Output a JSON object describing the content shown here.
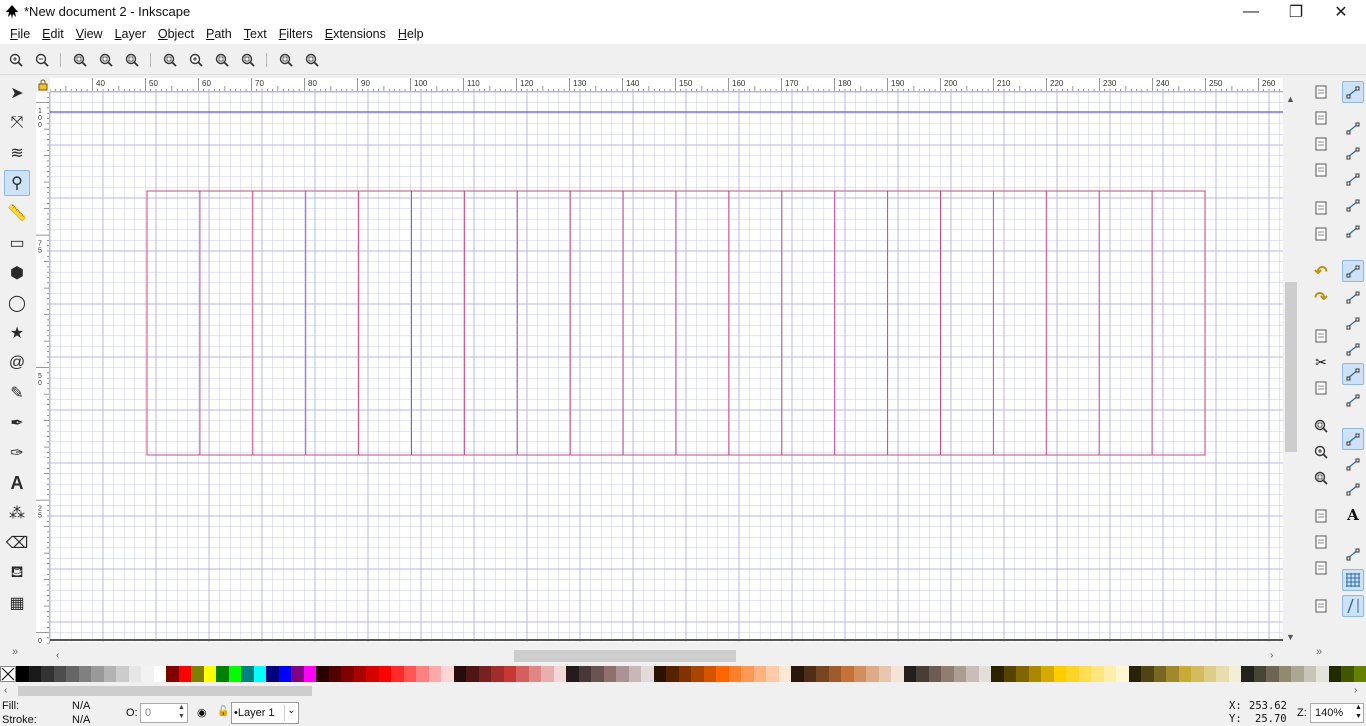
{
  "window": {
    "title": "*New document 2 - Inkscape",
    "minimize": "—",
    "restore": "❐",
    "close": "✕"
  },
  "menu": [
    "File",
    "Edit",
    "View",
    "Layer",
    "Object",
    "Path",
    "Text",
    "Filters",
    "Extensions",
    "Help"
  ],
  "commands": [
    "zoom-in-icon",
    "zoom-out-icon",
    "zoom-1to1-icon",
    "zoom-1to2-icon",
    "zoom-2to1-icon",
    "zoom-selection-icon",
    "zoom-drawing-icon",
    "zoom-page-icon",
    "zoom-page-width-icon",
    "zoom-previous-icon",
    "zoom-next-icon"
  ],
  "tools": [
    {
      "name": "selector-tool-icon",
      "glyph": "➤"
    },
    {
      "name": "node-tool-icon",
      "glyph": "⤧"
    },
    {
      "name": "tweak-tool-icon",
      "glyph": "≋"
    },
    {
      "name": "zoom-tool-icon",
      "glyph": "⚲"
    },
    {
      "name": "measure-tool-icon",
      "glyph": "📏"
    },
    {
      "name": "rectangle-tool-icon",
      "glyph": "▭"
    },
    {
      "name": "3d-box-tool-icon",
      "glyph": "⬢"
    },
    {
      "name": "ellipse-tool-icon",
      "glyph": "◯"
    },
    {
      "name": "star-tool-icon",
      "glyph": "★"
    },
    {
      "name": "spiral-tool-icon",
      "glyph": "@"
    },
    {
      "name": "pencil-tool-icon",
      "glyph": "✎"
    },
    {
      "name": "pen-tool-icon",
      "glyph": "✒"
    },
    {
      "name": "calligraphy-tool-icon",
      "glyph": "✑"
    },
    {
      "name": "text-tool-icon",
      "glyph": "A"
    },
    {
      "name": "spray-tool-icon",
      "glyph": "⁂"
    },
    {
      "name": "eraser-tool-icon",
      "glyph": "⌫"
    },
    {
      "name": "paint-bucket-tool-icon",
      "glyph": "⛾"
    },
    {
      "name": "gradient-tool-icon",
      "glyph": "▦"
    }
  ],
  "active_tool": "zoom-tool-icon",
  "hruler_labels": [
    "40",
    "50",
    "60",
    "70",
    "80",
    "90",
    "100",
    "110",
    "120",
    "130",
    "140",
    "150",
    "160",
    "170",
    "180",
    "190",
    "200",
    "210",
    "220",
    "230",
    "240",
    "250",
    "260"
  ],
  "vruler_labels": [
    "100",
    "75",
    "50",
    "25",
    "0"
  ],
  "drawing": {
    "stroke_color": "#d0457a",
    "grid_color": "#c8c8f0",
    "page_line_color": "#3a3aa0",
    "columns": 20
  },
  "sidebar_commands": [
    "new-document-icon",
    "open-icon",
    "save-icon",
    "print-icon",
    "import-icon",
    "export-icon",
    "undo-icon",
    "redo-icon",
    "copy-icon",
    "cut-icon",
    "paste-icon",
    "zoom-selection-icon",
    "zoom-drawing-icon",
    "zoom-page-icon",
    "duplicate-icon",
    "clone-icon",
    "unlink-clone-icon",
    "group-icon"
  ],
  "snap_controls": [
    "snap-enable-icon",
    "snap-bbox-icon",
    "snap-bbox-edge-icon",
    "snap-bbox-corner-icon",
    "snap-bbox-midpoint-icon",
    "snap-bbox-center-icon",
    "snap-nodes-icon",
    "snap-path-icon",
    "snap-intersection-icon",
    "snap-cusp-icon",
    "snap-smooth-icon",
    "snap-midpoint-icon",
    "snap-others-icon",
    "snap-object-center-icon",
    "snap-rotation-center-icon",
    "snap-text-baseline-icon",
    "snap-page-border-icon",
    "snap-grid-icon",
    "snap-guide-icon"
  ],
  "snap_on": [
    "snap-enable-icon",
    "snap-nodes-icon",
    "snap-smooth-icon",
    "snap-others-icon",
    "snap-grid-icon",
    "snap-guide-icon"
  ],
  "palette": [
    "#000000",
    "#1a1a1a",
    "#333333",
    "#4d4d4d",
    "#666666",
    "#808080",
    "#999999",
    "#b3b3b3",
    "#cccccc",
    "#e6e6e6",
    "#f2f2f2",
    "#ffffff",
    "#800000",
    "#ff0000",
    "#808000",
    "#ffff00",
    "#008000",
    "#00ff00",
    "#008080",
    "#00ffff",
    "#000080",
    "#0000ff",
    "#800080",
    "#ff00ff",
    "#2b0000",
    "#550000",
    "#800000",
    "#aa0000",
    "#d40000",
    "#ff0000",
    "#ff2a2a",
    "#ff5555",
    "#ff8080",
    "#ffaaaa",
    "#ffd5d5",
    "#280b0b",
    "#501616",
    "#782121",
    "#a02c2c",
    "#c83737",
    "#d35f5f",
    "#de8787",
    "#e9afaf",
    "#f4d7d7",
    "#241c1c",
    "#483737",
    "#6c5353",
    "#916f6f",
    "#ac9393",
    "#c8b7b7",
    "#e3dbdb",
    "#2b1100",
    "#552200",
    "#803300",
    "#aa4400",
    "#d45500",
    "#ff6600",
    "#ff7f2a",
    "#ff9955",
    "#ffb380",
    "#ffccaa",
    "#ffe6d5",
    "#28170b",
    "#502d16",
    "#784421",
    "#a05a2c",
    "#c87137",
    "#d38d5f",
    "#deaa87",
    "#e9c6af",
    "#f4e3d7",
    "#241f1c",
    "#483e37",
    "#6c5d53",
    "#917c6f",
    "#ac9d93",
    "#c8beb7",
    "#e3dedb",
    "#2b2200",
    "#554400",
    "#806600",
    "#aa8800",
    "#d4aa00",
    "#ffcc00",
    "#ffd42a",
    "#ffdd55",
    "#ffe680",
    "#ffeeaa",
    "#fff6d5",
    "#28220b",
    "#504416",
    "#786721",
    "#a0892c",
    "#c8ab37",
    "#d3bc5f",
    "#decd87",
    "#e9ddaf",
    "#f4eed7",
    "#24221c",
    "#484537",
    "#6c6753",
    "#918a6f",
    "#aca793",
    "#c8c4b7",
    "#e3e2db",
    "#222b00",
    "#445500",
    "#668000"
  ],
  "status": {
    "fill_label": "Fill:",
    "fill_value": "N/A",
    "stroke_label": "Stroke:",
    "stroke_value": "N/A",
    "opacity_label": "O:",
    "opacity_value": "0",
    "layer": "•Layer 1",
    "x_label": "X:",
    "x_value": "253.62",
    "y_label": "Y:",
    "y_value": "25.70",
    "zoom_label": "Z:",
    "zoom_value": "140%"
  }
}
